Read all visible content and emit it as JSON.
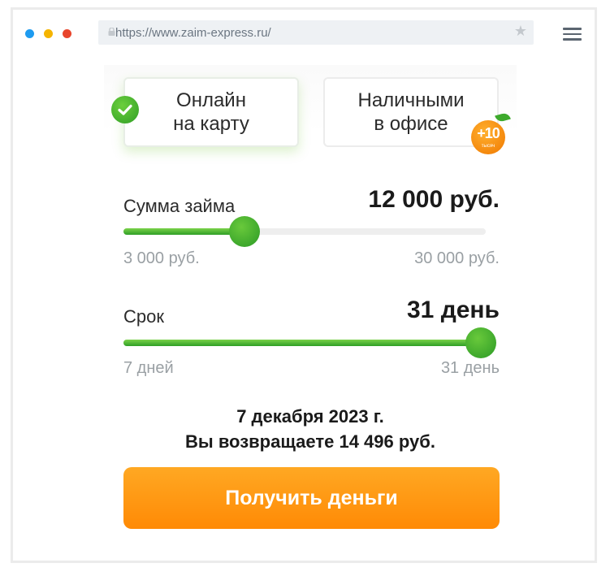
{
  "browser": {
    "url": "https://www.zaim-express.ru/"
  },
  "delivery_options": [
    {
      "label": "Онлайн на карту",
      "selected": true
    },
    {
      "label": "Наличными в офисе",
      "selected": false,
      "badge": {
        "number": "+10",
        "text": "тысяч"
      }
    }
  ],
  "amount": {
    "label": "Сумма займа",
    "value_text": "12 000 руб.",
    "value": 12000,
    "min_text": "3 000 руб.",
    "max_text": "30 000 руб.",
    "min": 3000,
    "max": 30000
  },
  "term": {
    "label": "Срок",
    "value_text": "31 день",
    "value": 31,
    "min_text": "7 дней",
    "max_text": "31 день",
    "min": 7,
    "max": 31
  },
  "summary": {
    "date": "7 декабря 2023 г.",
    "repay": "Вы возвращаете 14 496 руб."
  },
  "cta_label": "Получить деньги",
  "colors": {
    "accent_green": "#2f9e26",
    "cta_orange": "#ff9a14"
  }
}
